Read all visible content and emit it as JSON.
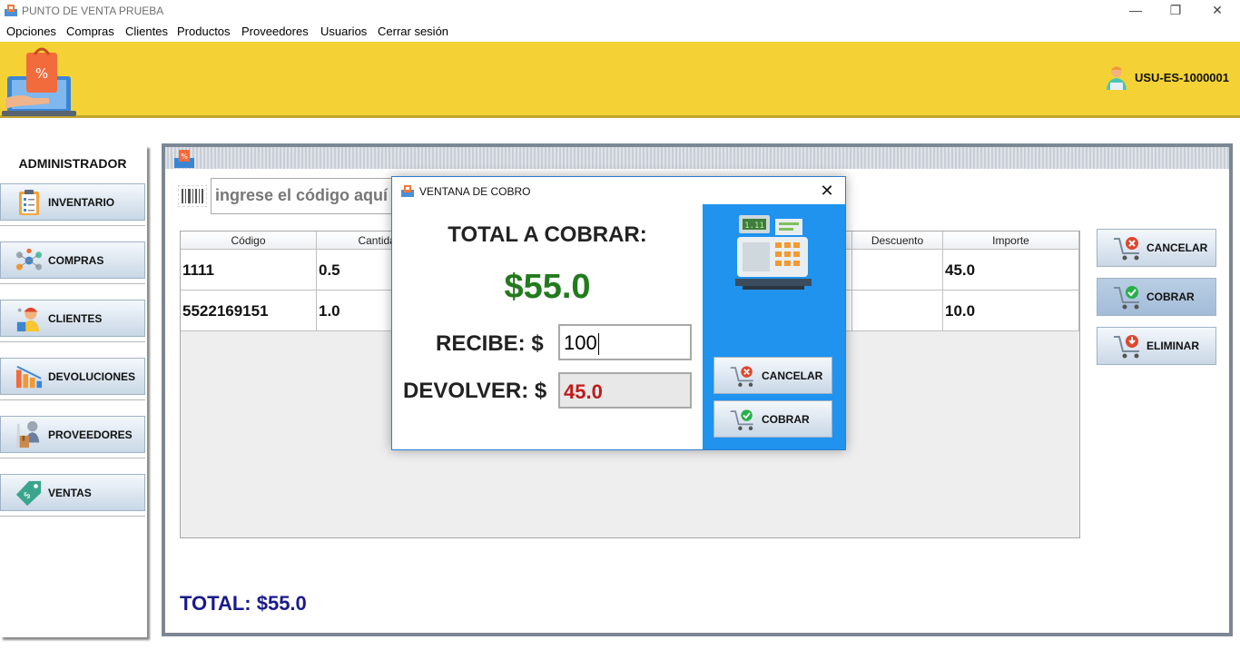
{
  "window": {
    "title": "PUNTO DE VENTA PRUEBA",
    "minimize": "—",
    "restore": "❐",
    "close": "✕"
  },
  "menu": [
    "Opciones",
    "Compras",
    "Clientes",
    "Productos",
    "Proveedores",
    "Usuarios",
    "Cerrar sesión"
  ],
  "header": {
    "user_id": "USU-ES-1000001",
    "bg_color": "#f4d235"
  },
  "sidebar": {
    "role": "ADMINISTRADOR",
    "items": [
      {
        "label": "INVENTARIO",
        "icon": "clipboard-icon"
      },
      {
        "label": "COMPRAS",
        "icon": "network-icon"
      },
      {
        "label": "CLIENTES",
        "icon": "customer-icon"
      },
      {
        "label": "DEVOLUCIONES",
        "icon": "bar-chart-icon"
      },
      {
        "label": "PROVEEDORES",
        "icon": "supplier-icon"
      },
      {
        "label": "VENTAS",
        "icon": "price-tag-icon"
      }
    ]
  },
  "sales": {
    "search_placeholder": "ingrese el código aquí",
    "columns": [
      "Código",
      "Cantidad",
      "",
      "",
      "",
      "Descuento",
      "Importe"
    ],
    "rows": [
      {
        "codigo": "1111",
        "cantidad": "0.5",
        "importe": "45.0"
      },
      {
        "codigo": "5522169151",
        "cantidad": "1.0",
        "importe": "10.0"
      }
    ],
    "actions": [
      "CANCELAR",
      "COBRAR",
      "ELIMINAR"
    ],
    "total": "TOTAL: $55.0"
  },
  "dialog": {
    "title": "VENTANA DE COBRO",
    "close": "✕",
    "total_label": "TOTAL A COBRAR:",
    "amount": "$55.0",
    "recibe_label": "RECIBE: $",
    "recibe_value": "100",
    "devolver_label": "DEVOLVER: $",
    "devolver_value": "45.0",
    "cancel": "CANCELAR",
    "charge": "COBRAR",
    "panel_color": "#1f93ee",
    "amount_color": "#237a1e",
    "change_color": "#c01a1a"
  }
}
